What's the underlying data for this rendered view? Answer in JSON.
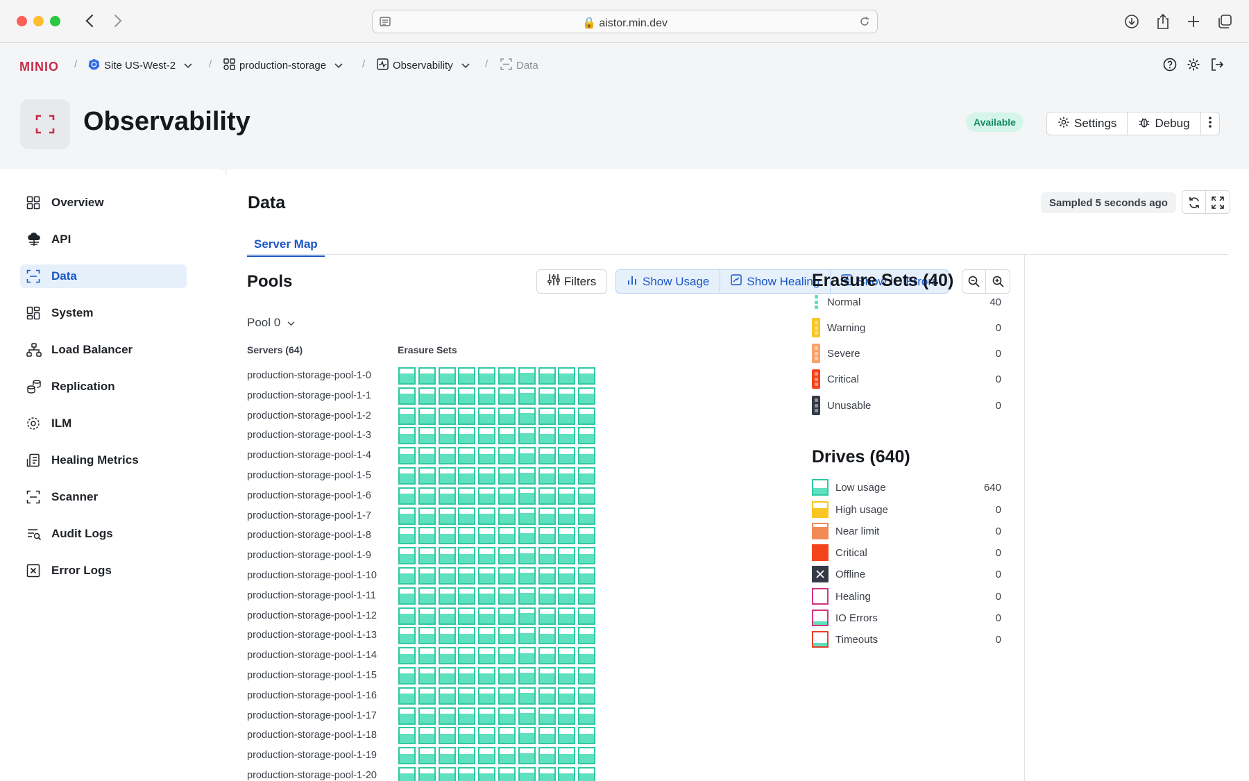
{
  "browser": {
    "url": "aistor.min.dev"
  },
  "breadcrumb": {
    "logo": "MINIO",
    "site": "Site US-West-2",
    "bucket": "production-storage",
    "section": "Observability",
    "current": "Data"
  },
  "page": {
    "title": "Observability",
    "status": "Available",
    "settings_label": "Settings",
    "debug_label": "Debug"
  },
  "sidebar": {
    "items": [
      {
        "label": "Overview",
        "icon": "grid-icon"
      },
      {
        "label": "API",
        "icon": "cloud-icon"
      },
      {
        "label": "Data",
        "icon": "scan-icon",
        "active": true
      },
      {
        "label": "System",
        "icon": "dashboard-icon"
      },
      {
        "label": "Load Balancer",
        "icon": "network-icon"
      },
      {
        "label": "Replication",
        "icon": "replication-icon"
      },
      {
        "label": "ILM",
        "icon": "lifecycle-icon"
      },
      {
        "label": "Healing Metrics",
        "icon": "healing-icon"
      },
      {
        "label": "Scanner",
        "icon": "scan-icon"
      },
      {
        "label": "Audit Logs",
        "icon": "log-search-icon"
      },
      {
        "label": "Error Logs",
        "icon": "error-box-icon"
      }
    ]
  },
  "main": {
    "title": "Data",
    "sampled": "Sampled 5 seconds ago",
    "tab": "Server Map",
    "pools_title": "Pools",
    "filters_label": "Filters",
    "toggles": [
      "Show Usage",
      "Show Healing",
      "Show IO Errors"
    ],
    "pool_selected": "Pool 0",
    "servers_header": "Servers (64)",
    "erasure_header": "Erasure Sets",
    "drives_per_server": 10,
    "servers": [
      "production-storage-pool-1-0",
      "production-storage-pool-1-1",
      "production-storage-pool-1-2",
      "production-storage-pool-1-3",
      "production-storage-pool-1-4",
      "production-storage-pool-1-5",
      "production-storage-pool-1-6",
      "production-storage-pool-1-7",
      "production-storage-pool-1-8",
      "production-storage-pool-1-9",
      "production-storage-pool-1-10",
      "production-storage-pool-1-11",
      "production-storage-pool-1-12",
      "production-storage-pool-1-13",
      "production-storage-pool-1-14",
      "production-storage-pool-1-15",
      "production-storage-pool-1-16",
      "production-storage-pool-1-17",
      "production-storage-pool-1-18",
      "production-storage-pool-1-19",
      "production-storage-pool-1-20"
    ]
  },
  "legend": {
    "erasure_title": "Erasure Sets (40)",
    "erasure": [
      {
        "label": "Normal",
        "count": "40",
        "color": "#5fe0bf"
      },
      {
        "label": "Warning",
        "count": "0",
        "color": "#f9c623"
      },
      {
        "label": "Severe",
        "count": "0",
        "color": "#f7a36b"
      },
      {
        "label": "Critical",
        "count": "0",
        "color": "#f5431c"
      },
      {
        "label": "Unusable",
        "count": "0",
        "color": "#343a45"
      }
    ],
    "drives_title": "Drives (640)",
    "drives": [
      {
        "label": "Low usage",
        "count": "640",
        "color": "#2ec9a3"
      },
      {
        "label": "High usage",
        "count": "0",
        "color": "#f9c623"
      },
      {
        "label": "Near limit",
        "count": "0",
        "color": "#f28a55"
      },
      {
        "label": "Critical",
        "count": "0",
        "color": "#f5431c"
      },
      {
        "label": "Offline",
        "count": "0",
        "color": "#343a45"
      },
      {
        "label": "Healing",
        "count": "0",
        "color": "#d4317e"
      },
      {
        "label": "IO Errors",
        "count": "0",
        "color": "#d4317e"
      },
      {
        "label": "Timeouts",
        "count": "0",
        "color": "#e8412b"
      }
    ]
  }
}
